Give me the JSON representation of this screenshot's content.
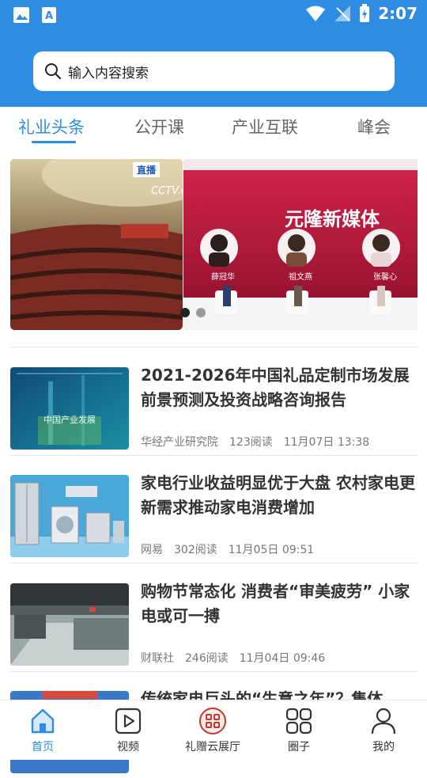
{
  "status_bar": {
    "time": "2:07"
  },
  "search": {
    "placeholder": "输入内容搜索"
  },
  "tabs": [
    {
      "label": "礼业头条",
      "active": true
    },
    {
      "label": "公开课",
      "active": false
    },
    {
      "label": "产业互联",
      "active": false
    },
    {
      "label": "峰会",
      "active": false
    }
  ],
  "banner": {
    "slide1": {
      "badge": "直播",
      "channel": "CCTV.com"
    },
    "slide2": {
      "headline": "元隆新媒体",
      "speakers": [
        {
          "name": "薛冠华"
        },
        {
          "name": "祖文燕"
        },
        {
          "name": "张馨心"
        }
      ]
    },
    "dots_count": 2,
    "active_dot": 0
  },
  "articles": [
    {
      "title": "2021-2026年中国礼品定制市场发展前景预测及投资战略咨询报告",
      "source": "华经产业研究院",
      "reads": "123阅读",
      "time": "11月07日 13:38",
      "thumb_text": "中国产业发展"
    },
    {
      "title": "家电行业收益明显优于大盘 农村家电更新需求推动家电消费增加",
      "source": "网易",
      "reads": "302阅读",
      "time": "11月05日 09:51"
    },
    {
      "title": "购物节常态化 消费者“审美疲劳” 小家电或可一搏",
      "source": "财联社",
      "reads": "246阅读",
      "time": "11月04日 09:46"
    },
    {
      "title": "传统家电巨头的“生意之年”？集体"
    }
  ],
  "bottom_nav": [
    {
      "label": "首页",
      "icon": "home-icon",
      "active": true
    },
    {
      "label": "视频",
      "icon": "video-icon",
      "active": false
    },
    {
      "label": "礼赠云展厅",
      "icon": "gift-hall-icon",
      "active": false
    },
    {
      "label": "圈子",
      "icon": "circle-grid-icon",
      "active": false
    },
    {
      "label": "我的",
      "icon": "profile-icon",
      "active": false
    }
  ],
  "colors": {
    "primary": "#2e8de3",
    "text": "#333333",
    "muted": "#777777",
    "accent_red": "#c0392b"
  }
}
